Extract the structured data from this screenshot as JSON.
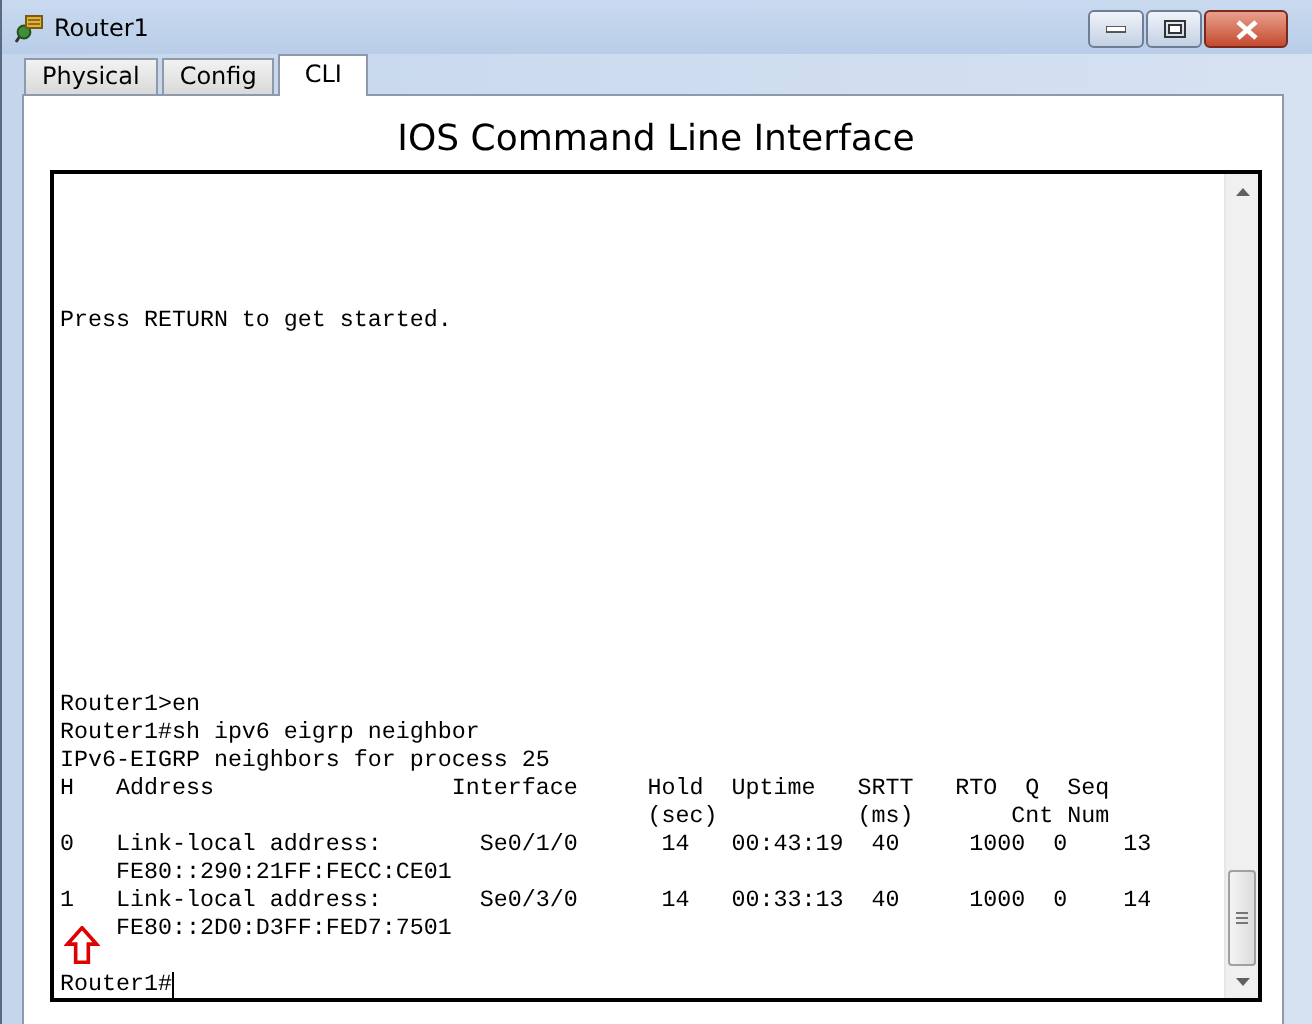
{
  "window": {
    "title": "Router1"
  },
  "tabs": [
    {
      "label": "Physical",
      "selected": false
    },
    {
      "label": "Config",
      "selected": false
    },
    {
      "label": "CLI",
      "selected": true
    }
  ],
  "heading": "IOS Command Line Interface",
  "terminal": {
    "banner_lines": [
      "Press RETURN to get started."
    ],
    "output_lines": [
      "Router1>en",
      "Router1#sh ipv6 eigrp neighbor",
      "IPv6-EIGRP neighbors for process 25",
      "H   Address                 Interface     Hold  Uptime   SRTT   RTO  Q  Seq",
      "                                          (sec)          (ms)       Cnt Num",
      "0   Link-local address:       Se0/1/0      14   00:43:19  40     1000  0    13",
      "    FE80::290:21FF:FECC:CE01",
      "1   Link-local address:       Se0/3/0      14   00:33:13  40     1000  0    14",
      "    FE80::2D0:D3FF:FED7:7501"
    ],
    "prompt": "Router1#"
  }
}
